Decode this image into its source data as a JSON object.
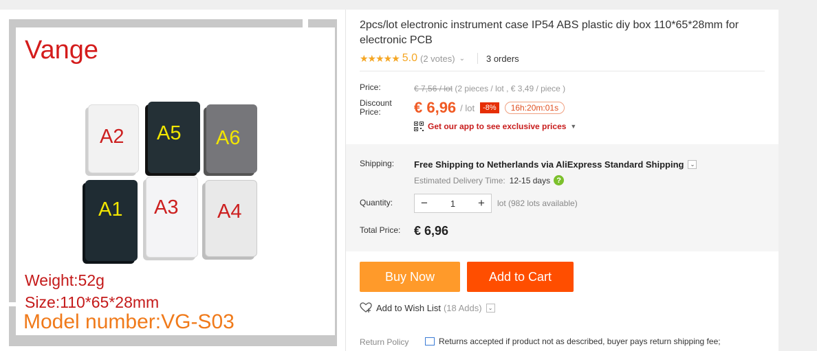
{
  "product": {
    "title": "2pcs/lot electronic instrument case IP54 ABS plastic diy box 110*65*28mm for electronic PCB",
    "rating": {
      "score": "5.0",
      "votes": "(2 votes)",
      "orders": "3 orders"
    }
  },
  "image": {
    "brand": "Vange",
    "weight": "Weight:52g",
    "size": "Size:110*65*28mm",
    "model": "Model number:VG-S03",
    "boxes": [
      {
        "label": "A2",
        "body": "#f2f2f2",
        "text": "#cc1f1f"
      },
      {
        "label": "A5",
        "body": "#243036",
        "text": "#f2e600"
      },
      {
        "label": "A6",
        "body": "#76767a",
        "text": "#f2e600"
      },
      {
        "label": "A1",
        "body": "#1f2c33",
        "text": "#f2e600"
      },
      {
        "label": "A3",
        "body": "#f4f4f6",
        "text": "#cc1f1f"
      },
      {
        "label": "A4",
        "body": "#e9e9e9",
        "text": "#cc1f1f"
      }
    ]
  },
  "pricing": {
    "price_label": "Price:",
    "old_price": "€ 7,56 / lot",
    "old_price_detail": "(2 pieces / lot , € 3,49 / piece )",
    "discount_label": "Discount Price:",
    "discount_amount": "€ 6,96",
    "discount_unit": "/ lot",
    "discount_badge": "-8%",
    "timer": "16h:20m:01s",
    "app_promo": "Get our app to see exclusive prices"
  },
  "shipping": {
    "label": "Shipping:",
    "summary": "Free Shipping to Netherlands via AliExpress Standard Shipping",
    "eta_label": "Estimated Delivery Time:",
    "eta_days": "12-15 days"
  },
  "quantity": {
    "label": "Quantity:",
    "minus": "−",
    "value": "1",
    "plus": "+",
    "available": "lot (982 lots available)"
  },
  "total": {
    "label": "Total Price:",
    "amount": "€ 6,96"
  },
  "actions": {
    "buy_now": "Buy Now",
    "add_to_cart": "Add to Cart"
  },
  "wishlist": {
    "label": "Add to Wish List",
    "count": "(18 Adds)"
  },
  "returns": {
    "label": "Return Policy",
    "text": "Returns accepted if product not as described, buyer pays return shipping fee;"
  },
  "colors": {
    "accent_orange": "#ff4e00",
    "buy_orange": "#ff9a2a",
    "price_red": "#f05a24",
    "star": "#f5a623"
  }
}
